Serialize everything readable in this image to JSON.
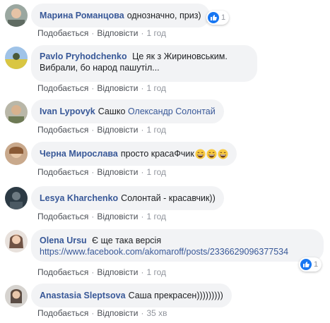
{
  "comments": [
    {
      "name": "Марина Романцова",
      "text": "однозначно, приз)",
      "reaction_count": "1",
      "like_label": "Подобається",
      "reply_label": "Відповісти",
      "time": "1 год"
    },
    {
      "name": "Pavlo Pryhodchenko",
      "text": "Це як з Жириновським. Вибрали, бо народ пашутіл...",
      "like_label": "Подобається",
      "reply_label": "Відповісти",
      "time": "1 год"
    },
    {
      "name": "Ivan Lypovyk",
      "text": "Сашко",
      "mention": "Олександр Солонтай",
      "like_label": "Подобається",
      "reply_label": "Відповісти",
      "time": "1 год"
    },
    {
      "name": "Черна Мирослава",
      "text": "просто красаФчик",
      "emoji": "grinning-face-emoji",
      "like_label": "Подобається",
      "reply_label": "Відповісти",
      "time": "1 год"
    },
    {
      "name": "Lesya Kharchenko",
      "text": "Солонтай - красавчик))",
      "like_label": "Подобається",
      "reply_label": "Відповісти",
      "time": "1 год"
    },
    {
      "name": "Olena Ursu",
      "text": "Є ще така версія",
      "link": "https://www.facebook.com/akomaroff/posts/2336629096377534",
      "reaction_count": "1",
      "like_label": "Подобається",
      "reply_label": "Відповісти",
      "time": "1 год"
    },
    {
      "name": "Anastasia Sleptsova",
      "text": "Саша прекрасен)))))))))",
      "like_label": "Подобається",
      "reply_label": "Відповісти",
      "time": "35 хв"
    }
  ],
  "colors": {
    "name": "#385898",
    "bubble": "#f2f3f5",
    "meta": "#90949c",
    "like_blue": "#1877f2"
  },
  "icons": {
    "reaction": "like-icon",
    "emoji": "grinning-face-emoji"
  }
}
